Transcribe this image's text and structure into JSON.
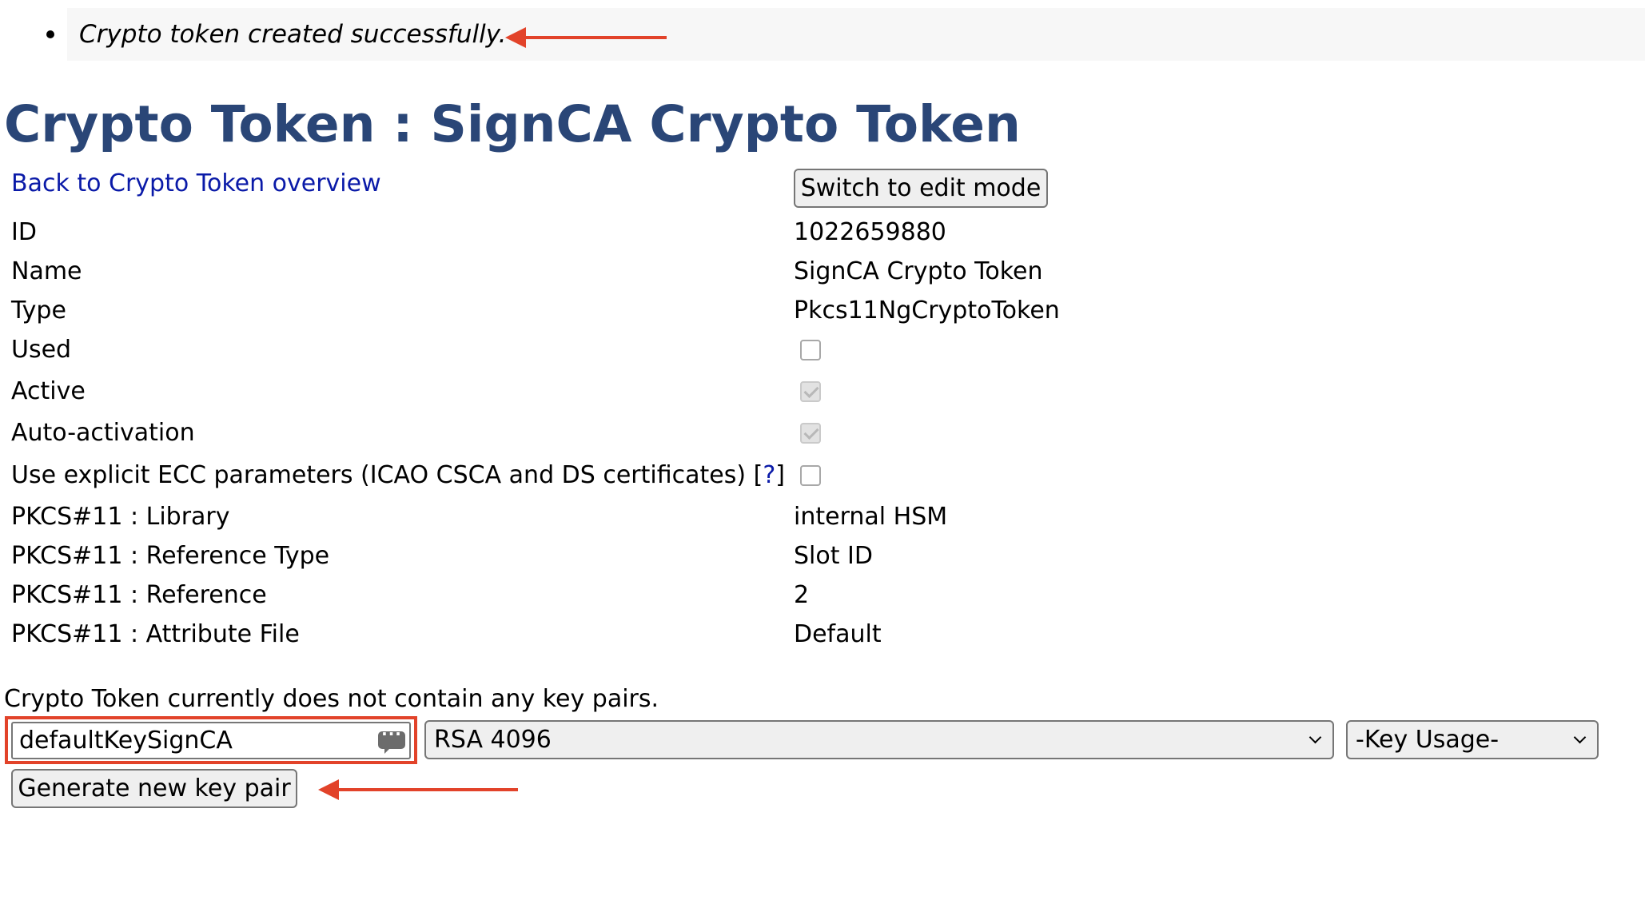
{
  "message": {
    "text": "Crypto token created successfully."
  },
  "page": {
    "title": "Crypto Token : SignCA Crypto Token",
    "back_link": "Back to Crypto Token overview",
    "edit_button": "Switch to edit mode"
  },
  "properties": [
    {
      "label": "ID",
      "value": "1022659880"
    },
    {
      "label": "Name",
      "value": "SignCA Crypto Token"
    },
    {
      "label": "Type",
      "value": "Pkcs11NgCryptoToken"
    },
    {
      "label": "Used",
      "checked": false
    },
    {
      "label": "Active",
      "checked": true
    },
    {
      "label": "Auto-activation",
      "checked": true
    },
    {
      "label": "Use explicit ECC parameters (ICAO CSCA and DS certificates)",
      "help_prefix": "[",
      "help_link": "?",
      "help_suffix": "]",
      "checked": false
    },
    {
      "label": "PKCS#11 : Library",
      "value": "internal HSM"
    },
    {
      "label": "PKCS#11 : Reference Type",
      "value": "Slot ID"
    },
    {
      "label": "PKCS#11 : Reference",
      "value": "2"
    },
    {
      "label": "PKCS#11 : Attribute File",
      "value": "Default"
    }
  ],
  "keypairs": {
    "empty_text": "Crypto Token currently does not contain any key pairs.",
    "alias_value": "defaultKeySignCA",
    "algorithm": "RSA 4096",
    "key_usage": "-Key Usage-",
    "generate_button": "Generate new key pair"
  },
  "colors": {
    "title": "#2a4677",
    "link": "#0a1aa8",
    "annotation": "#e2432a"
  },
  "icons": {
    "alias_field": "comment-icon",
    "dropdown": "chevron-down-icon"
  }
}
